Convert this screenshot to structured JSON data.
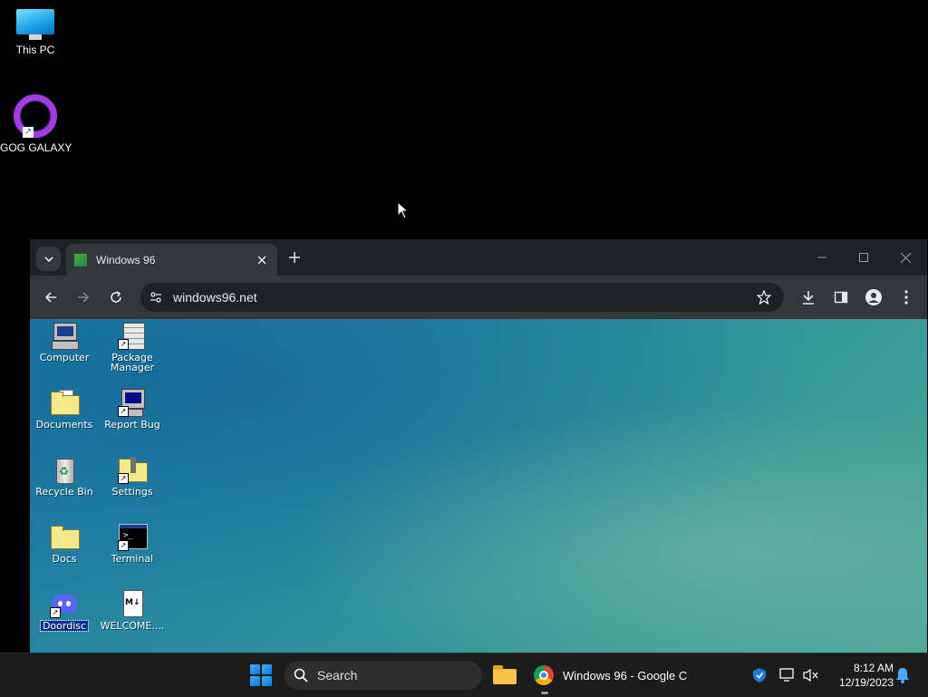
{
  "host_desktop": {
    "icons": [
      {
        "label": "This PC"
      },
      {
        "label": "GOG GALAXY"
      }
    ]
  },
  "browser": {
    "tab": {
      "title": "Windows 96"
    },
    "address": {
      "url": "windows96.net"
    },
    "page": {
      "icons": [
        {
          "label": "Computer"
        },
        {
          "label": "Package Manager"
        },
        {
          "label": "Documents"
        },
        {
          "label": "Report Bug"
        },
        {
          "label": "Recycle Bin"
        },
        {
          "label": "Settings"
        },
        {
          "label": "Docs"
        },
        {
          "label": "Terminal"
        },
        {
          "label": "Doordisc"
        },
        {
          "label": "WELCOME...."
        }
      ]
    }
  },
  "taskbar": {
    "search_label": "Search",
    "chrome_app_label": "Windows 96 - Google C",
    "clock": {
      "time": "8:12 AM",
      "date": "12/19/2023"
    }
  },
  "colors": {
    "accent": "#0a78d4",
    "browser_toolbar": "#35363a",
    "tabstrip": "#202124"
  }
}
